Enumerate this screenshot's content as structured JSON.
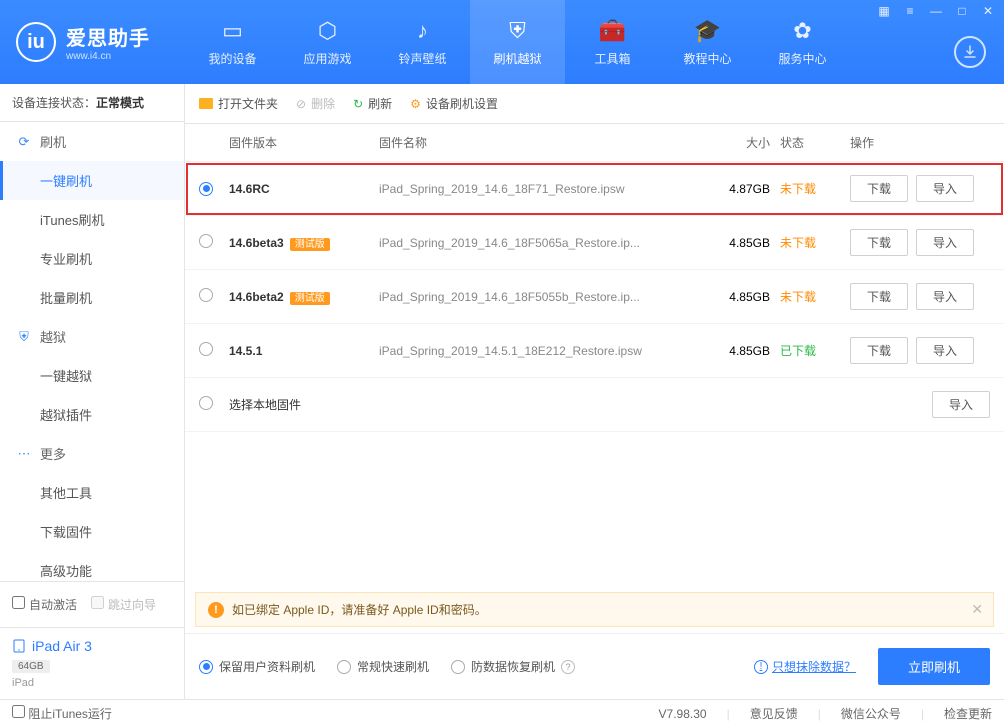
{
  "app": {
    "title": "爱思助手",
    "subtitle": "www.i4.cn"
  },
  "nav": [
    {
      "label": "我的设备"
    },
    {
      "label": "应用游戏"
    },
    {
      "label": "铃声壁纸"
    },
    {
      "label": "刷机越狱"
    },
    {
      "label": "工具箱"
    },
    {
      "label": "教程中心"
    },
    {
      "label": "服务中心"
    }
  ],
  "sidebar": {
    "status_label": "设备连接状态：",
    "status_value": "正常模式",
    "groups": [
      {
        "title": "刷机",
        "items": [
          "一键刷机",
          "iTunes刷机",
          "专业刷机",
          "批量刷机"
        ]
      },
      {
        "title": "越狱",
        "items": [
          "一键越狱",
          "越狱插件"
        ]
      },
      {
        "title": "更多",
        "items": [
          "其他工具",
          "下载固件",
          "高级功能"
        ]
      }
    ],
    "auto_activate": "自动激活",
    "skip_wizard": "跳过向导",
    "device_name": "iPad Air 3",
    "device_capacity": "64GB",
    "device_type": "iPad"
  },
  "toolbar": {
    "open_folder": "打开文件夹",
    "delete": "删除",
    "refresh": "刷新",
    "device_settings": "设备刷机设置"
  },
  "columns": {
    "version": "固件版本",
    "name": "固件名称",
    "size": "大小",
    "status": "状态",
    "action": "操作"
  },
  "rows": [
    {
      "version": "14.6RC",
      "test": false,
      "name": "iPad_Spring_2019_14.6_18F71_Restore.ipsw",
      "size": "4.87GB",
      "status": "未下载",
      "downloaded": false,
      "selected": true,
      "highlight": true
    },
    {
      "version": "14.6beta3",
      "test": true,
      "name": "iPad_Spring_2019_14.6_18F5065a_Restore.ip...",
      "size": "4.85GB",
      "status": "未下载",
      "downloaded": false
    },
    {
      "version": "14.6beta2",
      "test": true,
      "name": "iPad_Spring_2019_14.6_18F5055b_Restore.ip...",
      "size": "4.85GB",
      "status": "未下载",
      "downloaded": false
    },
    {
      "version": "14.5.1",
      "test": false,
      "name": "iPad_Spring_2019_14.5.1_18E212_Restore.ipsw",
      "size": "4.85GB",
      "status": "已下载",
      "downloaded": true
    }
  ],
  "local_row": {
    "label": "选择本地固件",
    "import": "导入"
  },
  "test_tag": "测试版",
  "row_buttons": {
    "download": "下载",
    "import": "导入"
  },
  "alert": "如已绑定 Apple ID，请准备好 Apple ID和密码。",
  "options": {
    "keep_data": "保留用户资料刷机",
    "normal": "常规快速刷机",
    "anti_recovery": "防数据恢复刷机",
    "erase_link": "只想抹除数据？",
    "go": "立即刷机"
  },
  "footer": {
    "block_itunes": "阻止iTunes运行",
    "version": "V7.98.30",
    "feedback": "意见反馈",
    "wechat": "微信公众号",
    "update": "检查更新"
  }
}
